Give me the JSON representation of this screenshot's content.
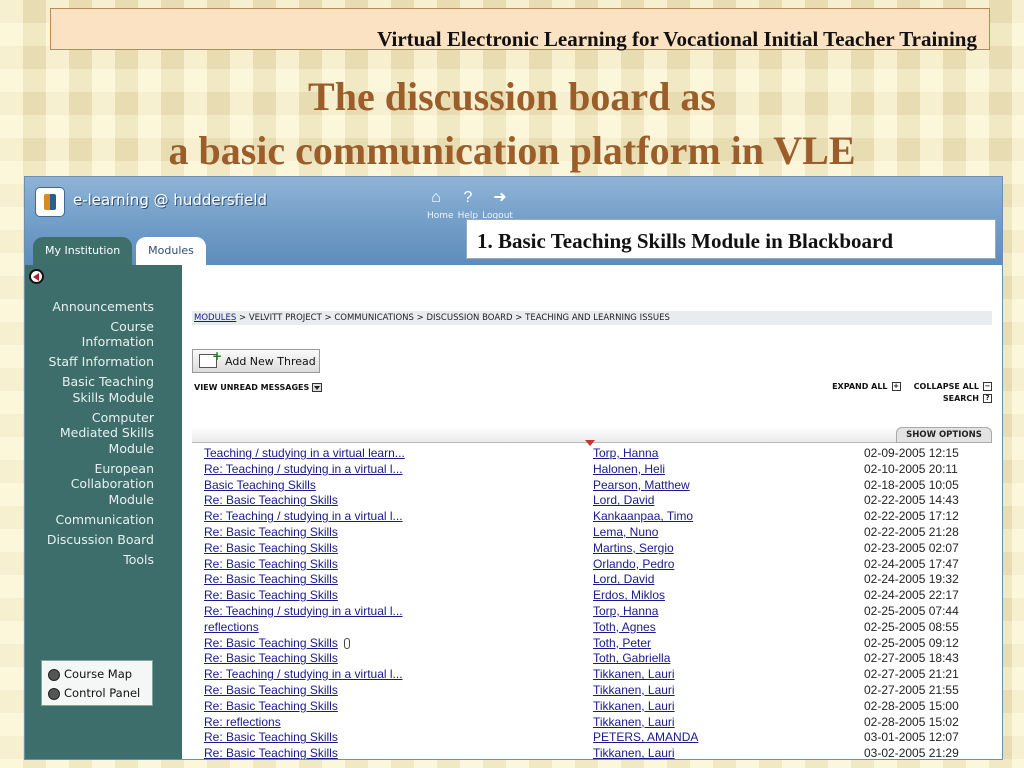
{
  "slide": {
    "banner": "Virtual Electronic Learning for Vocational Initial Teacher Training",
    "title_line1": "The discussion board as",
    "title_line2": "a basic communication platform in VLE",
    "callout": "1. Basic Teaching Skills Module in Blackboard"
  },
  "app": {
    "brand": "e-learning @ huddersfield",
    "top_nav": [
      "Home",
      "Help",
      "Logout"
    ],
    "tabs": [
      "My Institution",
      "Modules"
    ]
  },
  "sidebar": {
    "items": [
      "Announcements",
      "Course Information",
      "Staff Information",
      "Basic Teaching Skills Module",
      "Computer Mediated Skills Module",
      "European Collaboration Module",
      "Communication",
      "Discussion Board",
      "Tools"
    ],
    "tools": [
      "Course Map",
      "Control Panel"
    ]
  },
  "main": {
    "breadcrumb_link": "MODULES",
    "breadcrumb_rest": " > VELVITT PROJECT > COMMUNICATIONS > DISCUSSION BOARD > TEACHING AND LEARNING ISSUES",
    "add_thread": "Add New Thread",
    "view_unread": "VIEW UNREAD MESSAGES",
    "expand_all": "EXPAND ALL",
    "collapse_all": "COLLAPSE ALL",
    "search": "SEARCH",
    "show_options": "SHOW OPTIONS"
  },
  "threads": [
    {
      "subject": "Teaching / studying in a virtual learn...",
      "author": "Torp, Hanna",
      "date": "02-09-2005 12:15"
    },
    {
      "subject": "Re: Teaching / studying in a virtual l...",
      "author": "Halonen, Heli",
      "date": "02-10-2005 20:11"
    },
    {
      "subject": "Basic Teaching Skills",
      "author": "Pearson, Matthew",
      "date": "02-18-2005 10:05"
    },
    {
      "subject": "Re: Basic Teaching Skills",
      "author": "Lord, David",
      "date": "02-22-2005 14:43"
    },
    {
      "subject": "Re: Teaching / studying in a virtual l...",
      "author": "Kankaanpaa, Timo",
      "date": "02-22-2005 17:12"
    },
    {
      "subject": "Re: Basic Teaching Skills",
      "author": "Lema, Nuno",
      "date": "02-22-2005 21:28"
    },
    {
      "subject": "Re: Basic Teaching Skills",
      "author": "Martins, Sergio",
      "date": "02-23-2005 02:07"
    },
    {
      "subject": "Re: Basic Teaching Skills",
      "author": "Orlando, Pedro",
      "date": "02-24-2005 17:47"
    },
    {
      "subject": "Re: Basic Teaching Skills",
      "author": "Lord, David",
      "date": "02-24-2005 19:32"
    },
    {
      "subject": "Re: Basic Teaching Skills",
      "author": "Erdos, Miklos",
      "date": "02-24-2005 22:17"
    },
    {
      "subject": "Re: Teaching / studying in a virtual l...",
      "author": "Torp, Hanna",
      "date": "02-25-2005 07:44"
    },
    {
      "subject": "reflections",
      "author": "Toth, Agnes",
      "date": "02-25-2005 08:55"
    },
    {
      "subject": "Re: Basic Teaching Skills",
      "author": "Toth, Peter",
      "date": "02-25-2005 09:12",
      "attachment": true
    },
    {
      "subject": "Re: Basic Teaching Skills",
      "author": "Toth, Gabriella",
      "date": "02-27-2005 18:43"
    },
    {
      "subject": "Re: Teaching / studying in a virtual l...",
      "author": "Tikkanen, Lauri",
      "date": "02-27-2005 21:21"
    },
    {
      "subject": "Re: Basic Teaching Skills",
      "author": "Tikkanen, Lauri",
      "date": "02-27-2005 21:55"
    },
    {
      "subject": "Re: Basic Teaching Skills",
      "author": "Tikkanen, Lauri",
      "date": "02-28-2005 15:00"
    },
    {
      "subject": "Re: reflections",
      "author": "Tikkanen, Lauri",
      "date": "02-28-2005 15:02"
    },
    {
      "subject": "Re: Basic Teaching Skills",
      "author": "PETERS, AMANDA",
      "date": "03-01-2005 12:07"
    },
    {
      "subject": "Re: Basic Teaching Skills",
      "author": "Tikkanen, Lauri",
      "date": "03-02-2005 21:29"
    }
  ]
}
